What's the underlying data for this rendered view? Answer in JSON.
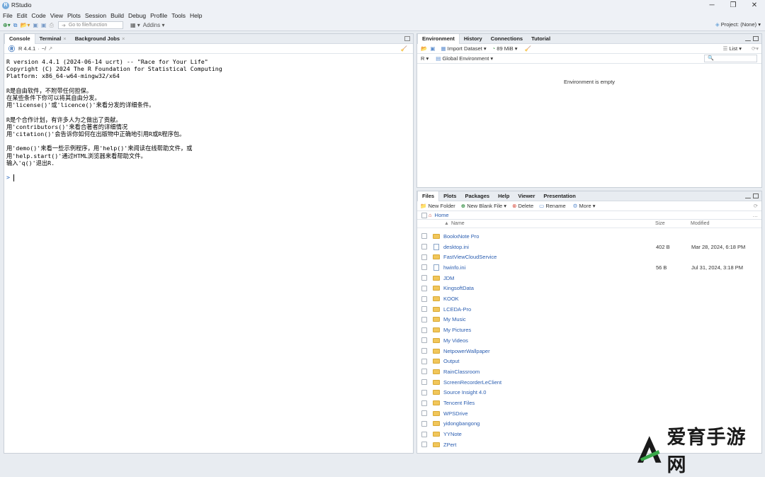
{
  "window": {
    "title": "RStudio",
    "app_icon": "R"
  },
  "menu": [
    "File",
    "Edit",
    "Code",
    "View",
    "Plots",
    "Session",
    "Build",
    "Debug",
    "Profile",
    "Tools",
    "Help"
  ],
  "toolbar": {
    "goto_placeholder": "Go to file/function",
    "addins": "Addins",
    "project": "Project: (None)"
  },
  "left_pane": {
    "tabs": [
      {
        "label": "Console",
        "closable": false
      },
      {
        "label": "Terminal",
        "closable": true
      },
      {
        "label": "Background Jobs",
        "closable": true
      }
    ],
    "r_version_label": "R 4.4.1",
    "path": "~/",
    "console_lines": [
      "R version 4.4.1 (2024-06-14 ucrt) -- \"Race for Your Life\"",
      "Copyright (C) 2024 The R Foundation for Statistical Computing",
      "Platform: x86_64-w64-mingw32/x64",
      "",
      "R是自由软件，不附带任何担保。",
      "在某些条件下你可以将其自由分发。",
      "用'license()'或'licence()'来看分发的详细条件。",
      "",
      "R是个合作计划，有许多人为之做出了贡献。",
      "用'contributors()'来看合著者的详细情况",
      "用'citation()'会告诉你如何在出版物中正确地引用R或R程序包。",
      "",
      "用'demo()'来看一些示例程序，用'help()'来阅读在线帮助文件，或",
      "用'help.start()'通过HTML浏览器来看帮助文件。",
      "输入'q()'退出R.",
      ""
    ],
    "prompt": ">"
  },
  "env_pane": {
    "tabs": [
      "Environment",
      "History",
      "Connections",
      "Tutorial"
    ],
    "import_dataset": "Import Dataset",
    "memory": "89 MiB",
    "view_mode": "List",
    "language": "R",
    "scope": "Global Environment",
    "empty_message": "Environment is empty"
  },
  "files_pane": {
    "tabs": [
      "Files",
      "Plots",
      "Packages",
      "Help",
      "Viewer",
      "Presentation"
    ],
    "actions": {
      "new_folder": "New Folder",
      "new_blank_file": "New Blank File",
      "delete": "Delete",
      "rename": "Rename",
      "more": "More"
    },
    "breadcrumb": "Home",
    "columns": {
      "name": "Name",
      "size": "Size",
      "modified": "Modified"
    },
    "files": [
      {
        "name": "BookxNote Pro",
        "type": "folder",
        "size": "",
        "modified": ""
      },
      {
        "name": "desktop.ini",
        "type": "file",
        "size": "402 B",
        "modified": "Mar 28, 2024, 6:18 PM"
      },
      {
        "name": "FastViewCloudService",
        "type": "folder",
        "size": "",
        "modified": ""
      },
      {
        "name": "hwinfo.ini",
        "type": "file",
        "size": "56 B",
        "modified": "Jul 31, 2024, 3:18 PM"
      },
      {
        "name": "JDM",
        "type": "folder",
        "size": "",
        "modified": ""
      },
      {
        "name": "KingsoftData",
        "type": "folder",
        "size": "",
        "modified": ""
      },
      {
        "name": "KOOK",
        "type": "folder",
        "size": "",
        "modified": ""
      },
      {
        "name": "LCEDA-Pro",
        "type": "folder",
        "size": "",
        "modified": ""
      },
      {
        "name": "My Music",
        "type": "folder",
        "size": "",
        "modified": ""
      },
      {
        "name": "My Pictures",
        "type": "folder",
        "size": "",
        "modified": ""
      },
      {
        "name": "My Videos",
        "type": "folder",
        "size": "",
        "modified": ""
      },
      {
        "name": "NetpowerWallpaper",
        "type": "folder",
        "size": "",
        "modified": ""
      },
      {
        "name": "Output",
        "type": "folder",
        "size": "",
        "modified": ""
      },
      {
        "name": "RainClassroom",
        "type": "folder",
        "size": "",
        "modified": ""
      },
      {
        "name": "ScreenRecorderLeClient",
        "type": "folder",
        "size": "",
        "modified": ""
      },
      {
        "name": "Source Insight 4.0",
        "type": "folder",
        "size": "",
        "modified": ""
      },
      {
        "name": "Tencent Files",
        "type": "folder",
        "size": "",
        "modified": ""
      },
      {
        "name": "WPSDrive",
        "type": "folder",
        "size": "",
        "modified": ""
      },
      {
        "name": "yidongbangong",
        "type": "folder",
        "size": "",
        "modified": ""
      },
      {
        "name": "YYNote",
        "type": "folder",
        "size": "",
        "modified": ""
      },
      {
        "name": "ZPert",
        "type": "folder",
        "size": "",
        "modified": ""
      }
    ]
  },
  "watermark": {
    "text": "爱育手游网",
    "logo_letter": "A"
  },
  "colors": {
    "accent": "#75aadb",
    "link": "#2a5db0",
    "folder": "#f1c65a",
    "watermark_green": "#3aa94a"
  }
}
